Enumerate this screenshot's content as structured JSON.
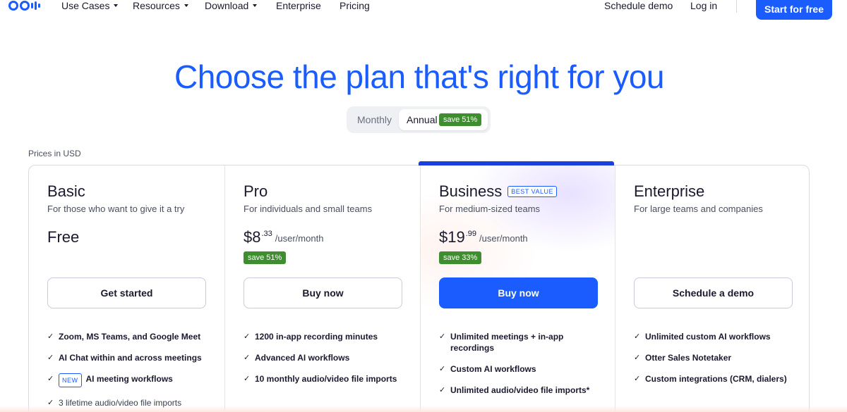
{
  "nav": {
    "items": [
      {
        "label": "Use Cases",
        "dropdown": true
      },
      {
        "label": "Resources",
        "dropdown": true
      },
      {
        "label": "Download",
        "dropdown": true
      },
      {
        "label": "Enterprise",
        "dropdown": false
      },
      {
        "label": "Pricing",
        "dropdown": false
      }
    ],
    "schedule_demo": "Schedule demo",
    "log_in": "Log in",
    "start_free": "Start for free"
  },
  "hero": {
    "title": "Choose the plan that's right for you"
  },
  "billing_toggle": {
    "monthly": "Monthly",
    "annual": "Annual",
    "annual_save": "save 51%",
    "selected": "Annual"
  },
  "prices_note": "Prices in USD",
  "plans": [
    {
      "name": "Basic",
      "desc": "For those who want to give it a try",
      "price_text": "Free",
      "cta": "Get started",
      "features": [
        {
          "text": "Zoom, MS Teams, and Google Meet"
        },
        {
          "text": "AI Chat within and across meetings"
        },
        {
          "text": "AI meeting workflows",
          "badge": "NEW"
        },
        {
          "text": "3 lifetime audio/video file imports"
        }
      ]
    },
    {
      "name": "Pro",
      "desc": "For individuals and small teams",
      "price_main": "$8",
      "price_cents": ".33",
      "price_per": "/user/month",
      "save": "save 51%",
      "cta": "Buy now",
      "features": [
        {
          "text": "1200 in-app recording minutes"
        },
        {
          "text": "Advanced AI workflows"
        },
        {
          "text": "10 monthly audio/video file imports"
        }
      ]
    },
    {
      "name": "Business",
      "badge": "BEST VALUE",
      "desc": "For medium-sized teams",
      "price_main": "$19",
      "price_cents": ".99",
      "price_per": "/user/month",
      "save": "save 33%",
      "cta": "Buy now",
      "features": [
        {
          "text": "Unlimited meetings + in-app recordings"
        },
        {
          "text": "Custom AI workflows"
        },
        {
          "text": "Unlimited audio/video file imports*"
        }
      ]
    },
    {
      "name": "Enterprise",
      "desc": "For large teams and companies",
      "cta": "Schedule a demo",
      "features": [
        {
          "text": "Unlimited custom AI workflows"
        },
        {
          "text": "Otter Sales Notetaker"
        },
        {
          "text": "Custom integrations (CRM, dialers)"
        }
      ]
    }
  ],
  "colors": {
    "brand": "#1a5cff",
    "save_green": "#3e8e2f",
    "accent_bar": "#1a3fe0"
  }
}
